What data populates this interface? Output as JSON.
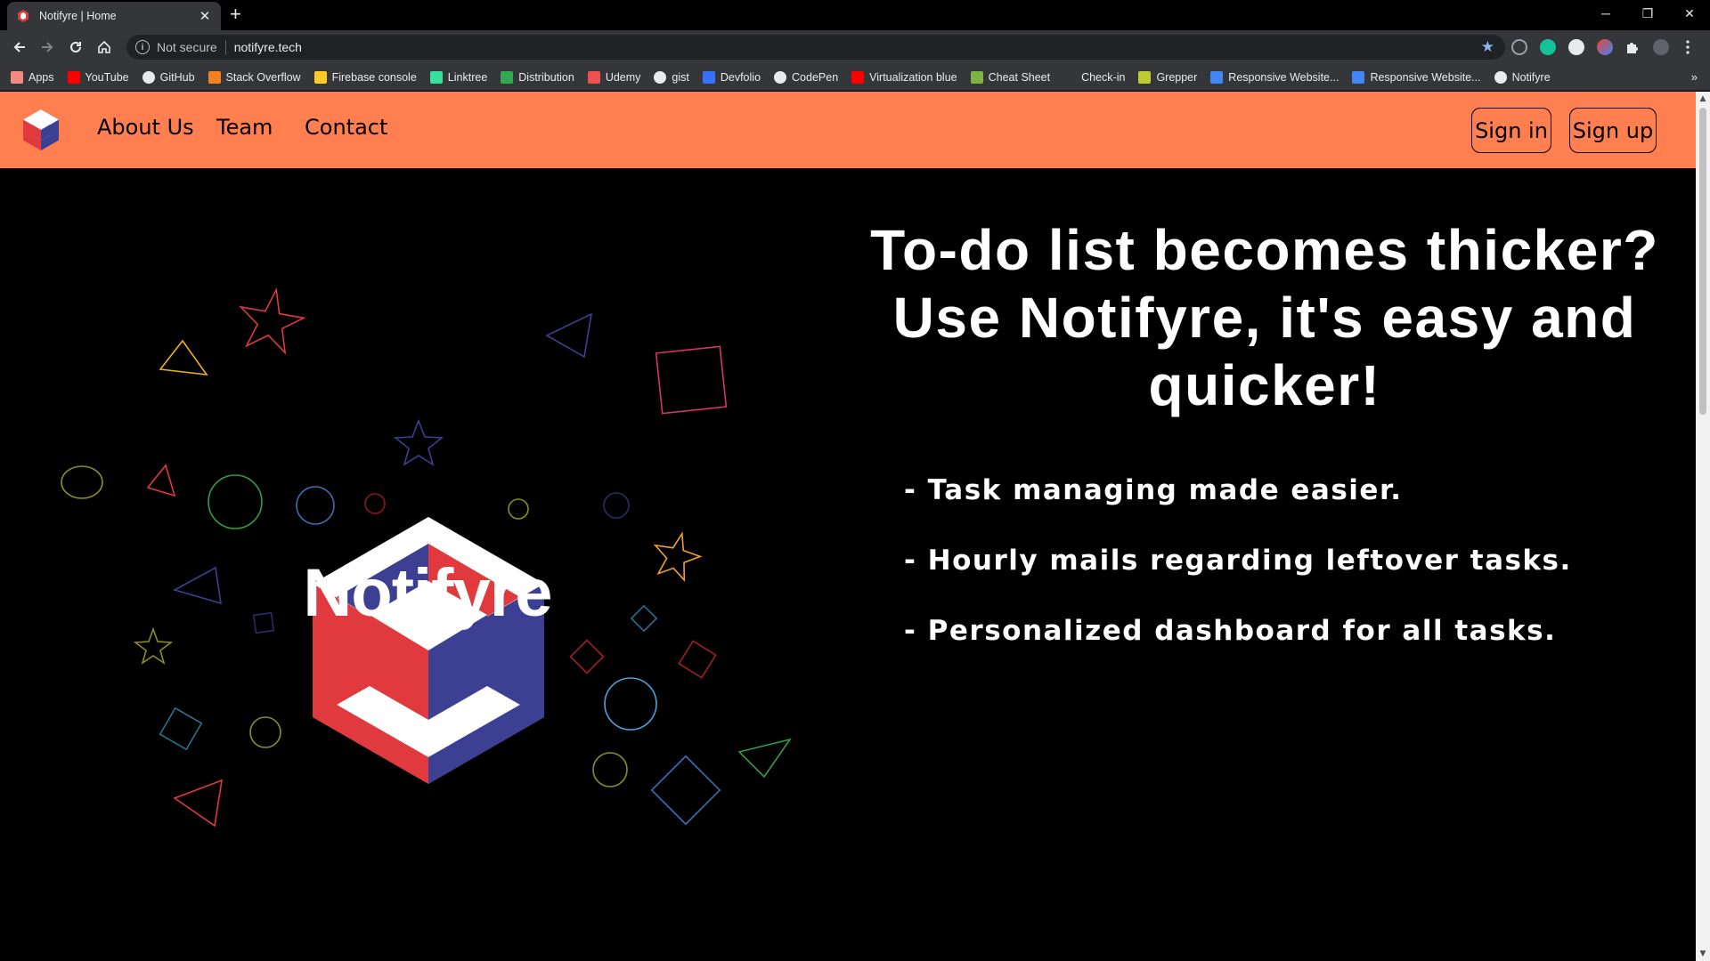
{
  "browser": {
    "tab_title": "Notifyre | Home",
    "tab_close": "✕",
    "new_tab": "+",
    "window_controls": {
      "minimize": "─",
      "restore": "❐",
      "close": "✕"
    },
    "security_label": "Not secure",
    "url": "notifyre.tech",
    "bookmark_star": "★",
    "bookmarks": [
      {
        "label": "Apps",
        "icon": "apps-grid-icon",
        "color": "#f28b82"
      },
      {
        "label": "YouTube",
        "icon": "youtube-icon",
        "color": "#ff0000"
      },
      {
        "label": "GitHub",
        "icon": "github-icon",
        "color": "#e8eaed"
      },
      {
        "label": "Stack Overflow",
        "icon": "stackoverflow-icon",
        "color": "#f48024"
      },
      {
        "label": "Firebase console",
        "icon": "firebase-icon",
        "color": "#ffca28"
      },
      {
        "label": "Linktree",
        "icon": "linktree-icon",
        "color": "#39e09b"
      },
      {
        "label": "Distribution",
        "icon": "distribution-icon",
        "color": "#34a853"
      },
      {
        "label": "Udemy",
        "icon": "udemy-icon",
        "color": "#ec5252"
      },
      {
        "label": "gist",
        "icon": "github-icon",
        "color": "#e8eaed"
      },
      {
        "label": "Devfolio",
        "icon": "devfolio-icon",
        "color": "#3770ff"
      },
      {
        "label": "CodePen",
        "icon": "codepen-icon",
        "color": "#e8eaed"
      },
      {
        "label": "Virtualization blue",
        "icon": "youtube-icon",
        "color": "#ff0000"
      },
      {
        "label": "Cheat Sheet",
        "icon": "cheatsheet-icon",
        "color": "#7cb342"
      },
      {
        "label": "Check-in",
        "icon": "checkin-icon",
        "color": "#35363a"
      },
      {
        "label": "Grepper",
        "icon": "grepper-icon",
        "color": "#c0ca33"
      },
      {
        "label": "Responsive Website...",
        "icon": "responsive-icon",
        "color": "#4285f4"
      },
      {
        "label": "Responsive Website...",
        "icon": "responsive-icon",
        "color": "#4285f4"
      },
      {
        "label": "Notifyre",
        "icon": "globe-icon",
        "color": "#e8eaed"
      }
    ],
    "bookmarks_more": "»"
  },
  "navbar": {
    "background": "#ff7f50",
    "links": [
      "About Us",
      "Team",
      "Contact"
    ],
    "sign_in": "Sign in",
    "sign_up": "Sign up"
  },
  "hero": {
    "brand_name": "Notifyre",
    "headline_lines": [
      "To-do list becomes thicker?",
      "Use Notifyre, it's easy and",
      "quicker!"
    ],
    "features": [
      "- Task managing made easier.",
      "- Hourly mails regarding leftover tasks.",
      "- Personalized dashboard for all tasks."
    ]
  },
  "colors": {
    "logo_red": "#e0393e",
    "logo_blue": "#3d3f93",
    "logo_white": "#ffffff",
    "shape_palette": [
      "#e0393e",
      "#3d3f93",
      "#e7b416",
      "#2f9e44",
      "#4aa3df",
      "#d6336c",
      "#8a8f1e",
      "#f0a030"
    ]
  }
}
